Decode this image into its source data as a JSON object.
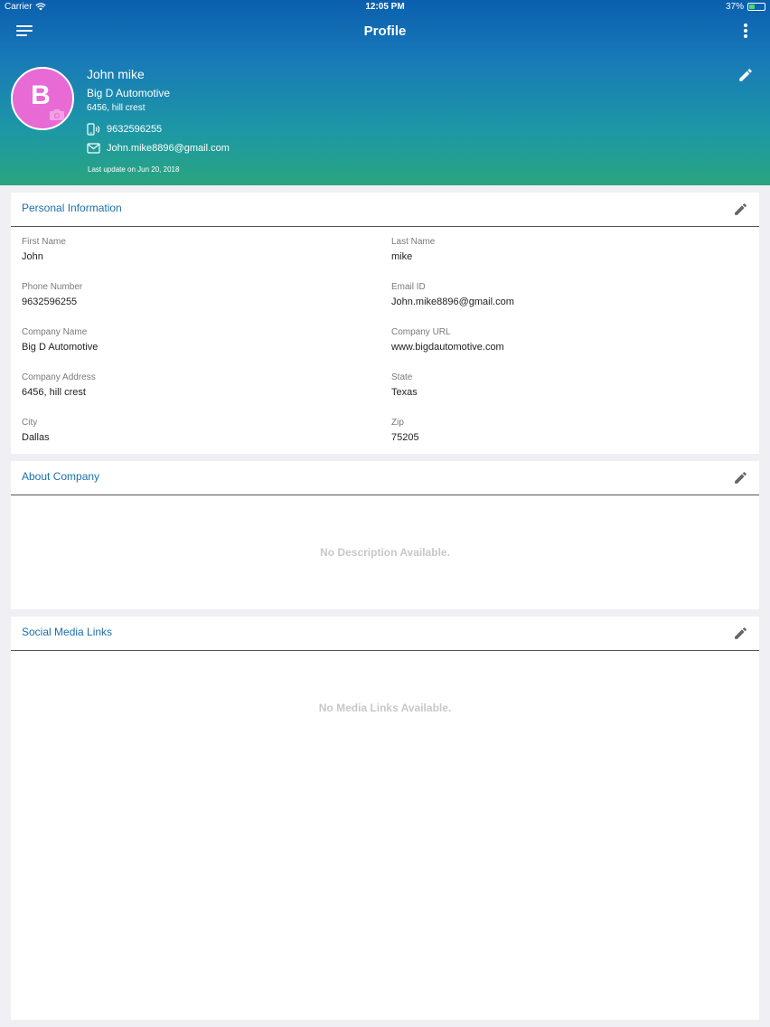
{
  "status_bar": {
    "carrier": "Carrier",
    "time": "12:05 PM",
    "battery": "37%",
    "battery_level": 0.37
  },
  "nav": {
    "title": "Profile"
  },
  "profile": {
    "avatar_letter": "B",
    "name": "John mike",
    "company": "Big D Automotive",
    "address": "6456, hill crest",
    "phone": "9632596255",
    "email": "John.mike8896@gmail.com",
    "last_update": "Last update on Jun 20, 2018"
  },
  "personal_info": {
    "title": "Personal Information",
    "fields": [
      {
        "label": "First Name",
        "value": "John"
      },
      {
        "label": "Last Name",
        "value": "mike"
      },
      {
        "label": "Phone Number",
        "value": "9632596255"
      },
      {
        "label": "Email ID",
        "value": "John.mike8896@gmail.com"
      },
      {
        "label": "Company Name",
        "value": "Big D Automotive"
      },
      {
        "label": "Company URL",
        "value": "www.bigdautomotive.com"
      },
      {
        "label": "Company Address",
        "value": "6456, hill crest"
      },
      {
        "label": "State",
        "value": "Texas"
      },
      {
        "label": "City",
        "value": "Dallas"
      },
      {
        "label": "Zip",
        "value": "75205"
      }
    ]
  },
  "about_company": {
    "title": "About Company",
    "empty_text": "No Description Available."
  },
  "social_links": {
    "title": "Social Media Links",
    "empty_text": "No Media Links Available."
  },
  "colors": {
    "accent": "#1b6fae",
    "avatar": "#e86ad5",
    "gradient_top": "#0a5fad",
    "gradient_bottom": "#2aa57f"
  }
}
